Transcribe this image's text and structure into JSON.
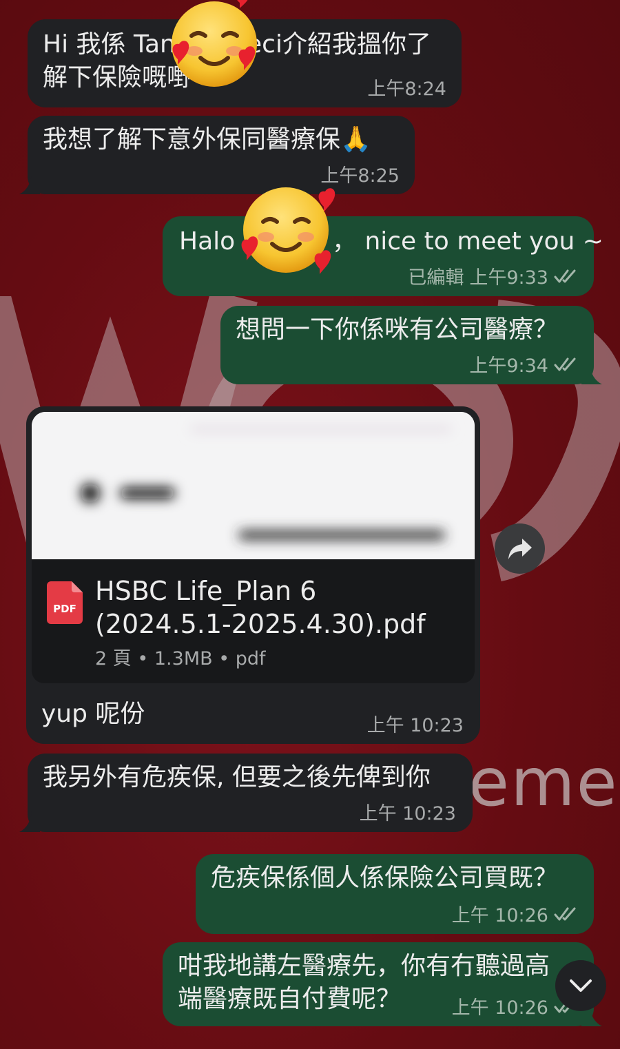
{
  "colors": {
    "incoming": "#202124",
    "outgoing": "#1b4d33",
    "background": "#6e0d13",
    "meta": "#a8aaab"
  },
  "background": {
    "watermark_text": "emen"
  },
  "messages": [
    {
      "id": "m1",
      "direction": "incoming",
      "lines": [
        "Hi 我係 Tan",
        "解下保險嘅嘢"
      ],
      "line1_right": "eci介紹我搵你了",
      "time": "上午8:24"
    },
    {
      "id": "m2",
      "direction": "incoming",
      "lines": [
        "我想了解下意外保同醫療保🙏"
      ],
      "time": "上午8:25"
    },
    {
      "id": "m3",
      "direction": "outgoing",
      "text_left": "Halo",
      "text_right": "， nice to meet you ~",
      "edited": "已編輯",
      "time": "上午9:33",
      "status_icon": "double-check-icon"
    },
    {
      "id": "m4",
      "direction": "outgoing",
      "lines": [
        "想問一下你係咪有公司醫療？"
      ],
      "time": "上午9:34",
      "status_icon": "double-check-icon"
    },
    {
      "id": "m5",
      "direction": "incoming",
      "document": {
        "name_line1": "HSBC Life_Plan 6",
        "name_line2": "(2024.5.1-2025.4.30).pdf",
        "pages": "2 頁",
        "size": "1.3MB",
        "ext": "pdf",
        "icon_label": "PDF"
      },
      "caption": "yup 呢份",
      "time": "上午 10:23"
    },
    {
      "id": "m6",
      "direction": "incoming",
      "lines": [
        "我另外有危疾保, 但要之後先俾到你"
      ],
      "time": "上午 10:23"
    },
    {
      "id": "m7",
      "direction": "outgoing",
      "lines": [
        "危疾保係個人係保險公司買既？"
      ],
      "time": "上午 10:26",
      "status_icon": "double-check-icon"
    },
    {
      "id": "m8",
      "direction": "outgoing",
      "lines": [
        "咁我地講左醫療先，你有冇聽過高",
        "端醫療既自付費呢？"
      ],
      "time": "上午 10:26",
      "status_icon": "double-check-icon"
    }
  ],
  "buttons": {
    "forward": "forward-icon",
    "scroll_down": "chevron-down-icon"
  },
  "emoji": "smiling-face-with-hearts"
}
